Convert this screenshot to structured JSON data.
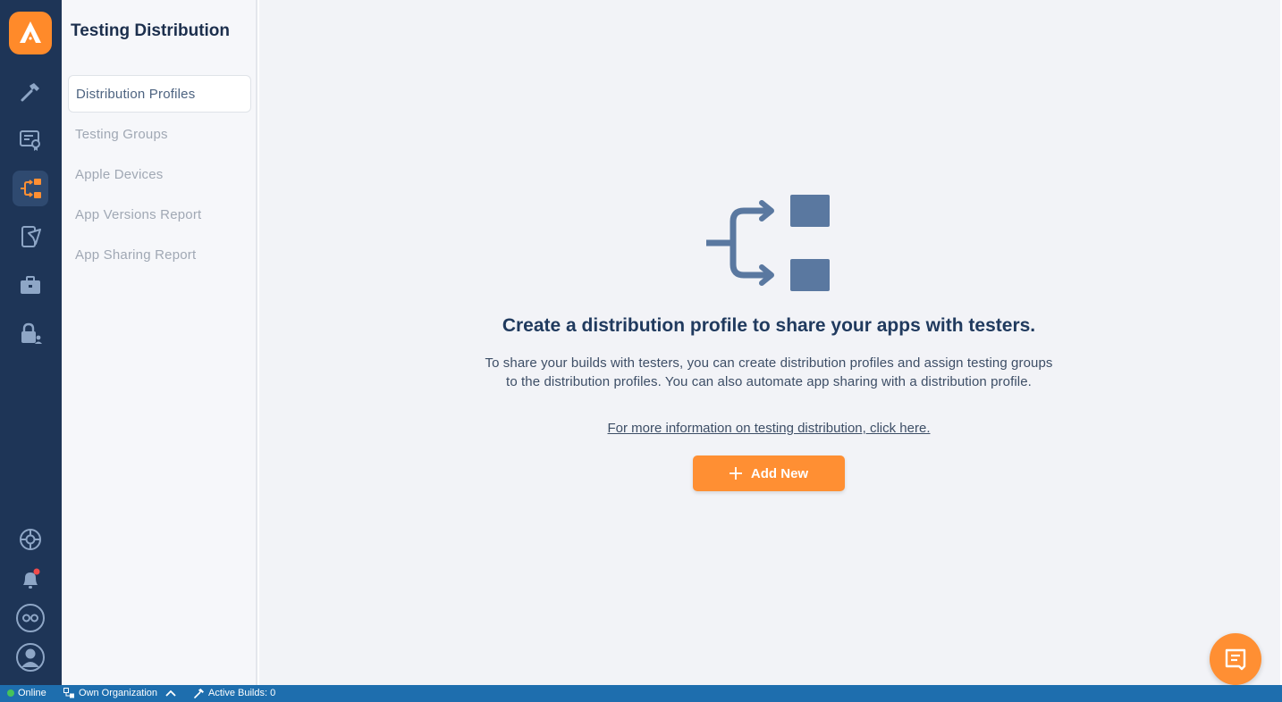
{
  "sidebar": {
    "title": "Testing Distribution",
    "items": [
      {
        "label": "Distribution Profiles",
        "active": true
      },
      {
        "label": "Testing Groups",
        "active": false
      },
      {
        "label": "Apple Devices",
        "active": false
      },
      {
        "label": "App Versions Report",
        "active": false
      },
      {
        "label": "App Sharing Report",
        "active": false
      }
    ]
  },
  "rail": {
    "icons": [
      "app-logo-icon",
      "hammer-icon",
      "certificate-icon",
      "distribution-icon",
      "device-send-icon",
      "briefcase-icon",
      "lock-user-icon",
      "help-wheel-icon",
      "bell-icon",
      "infinity-icon",
      "user-avatar-icon"
    ],
    "active": "distribution-icon"
  },
  "main": {
    "headline": "Create a distribution profile to share your apps with testers.",
    "description_line1": "To share your builds with testers, you can create distribution profiles and assign testing groups",
    "description_line2": "to the distribution profiles. You can also automate app sharing with a distribution profile.",
    "more_link": "For more information on testing distribution, click here.",
    "add_button": "Add New"
  },
  "statusbar": {
    "online": "Online",
    "organization": "Own Organization",
    "active_builds": "Active Builds: 0"
  },
  "colors": {
    "rail": "#1e3557",
    "accent": "#ff8f33",
    "statusbar": "#1e6eae",
    "illustration": "#5a78a0"
  }
}
